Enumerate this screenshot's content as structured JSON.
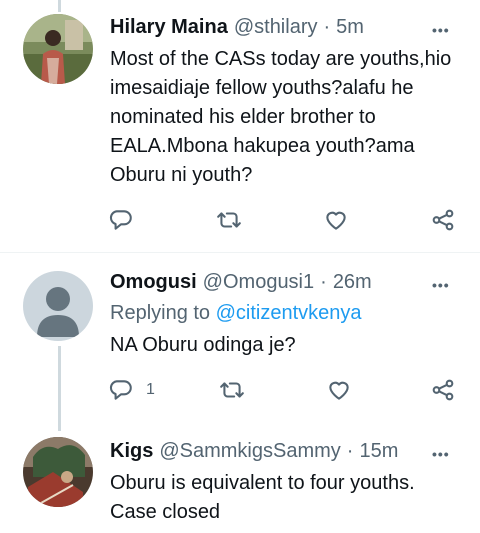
{
  "tweets": [
    {
      "name": "Hilary Maina",
      "handle": "@sthilary",
      "dot": "·",
      "time": "5m",
      "more": "•••",
      "text": "Most of the CASs today are youths,hio imesaidiaje fellow youths?alafu he nominated his elder brother to EALA.Mbona hakupea youth?ama Oburu ni youth?",
      "reply_count": "",
      "avatar": "photo-icon"
    },
    {
      "name": "Omogusi",
      "handle": "@Omogusi1",
      "dot": "·",
      "time": "26m",
      "more": "•••",
      "replying_label": "Replying to ",
      "replying_to": "@citizentvkenya",
      "text": "NA Oburu odinga je?",
      "reply_count": "1",
      "avatar": "default-profile-icon"
    },
    {
      "name": "Kigs",
      "handle": "@SammkigsSammy",
      "dot": "·",
      "time": "15m",
      "more": "•••",
      "text": "Oburu is equivalent to four youths. Case closed",
      "avatar": "photo-icon"
    }
  ],
  "icons": [
    "reply-icon",
    "retweet-icon",
    "like-icon",
    "share-icon"
  ],
  "colors": {
    "text": "#0f1419",
    "secondary": "#536471",
    "link": "#1d9bf0",
    "line": "#cfd9de"
  }
}
